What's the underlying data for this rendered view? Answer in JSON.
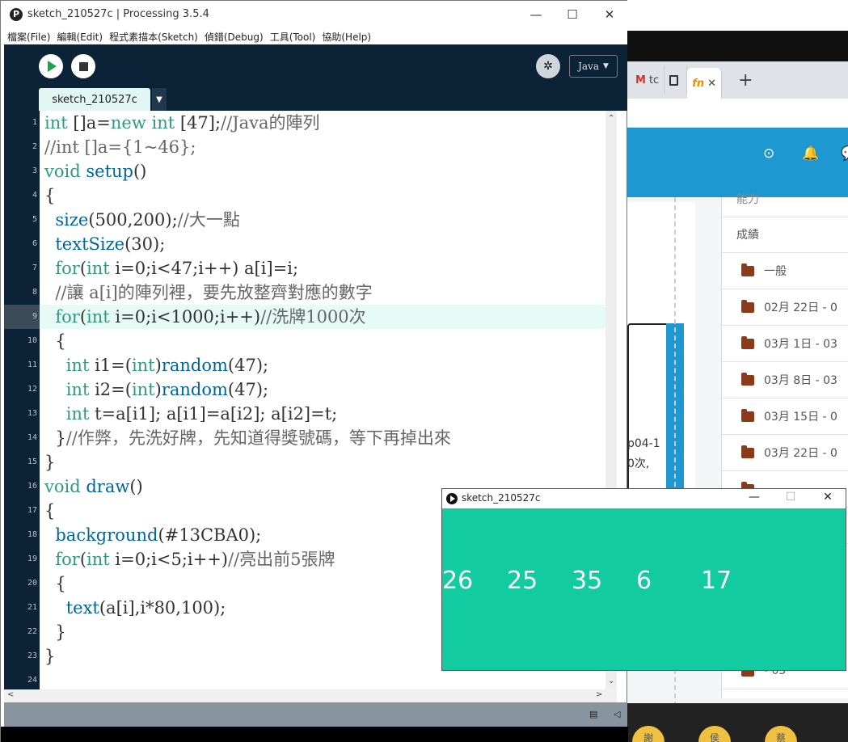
{
  "ide": {
    "window_title": "sketch_210527c | Processing 3.5.4",
    "app_icon_glyph": "P",
    "window_controls": {
      "minimize": "—",
      "maximize": "☐",
      "close": "✕"
    },
    "menu": [
      "檔案(File)",
      "編輯(Edit)",
      "程式素描本(Sketch)",
      "偵錯(Debug)",
      "工具(Tool)",
      "協助(Help)"
    ],
    "mode_label": "Java",
    "mode_arrow": "▼",
    "debug_glyph": "✲",
    "tab_name": "sketch_210527c",
    "tab_arrow": "▼",
    "highlighted_line": 9,
    "colors": {
      "toolbar_bg": "#0c2236",
      "keyword": "#33997e",
      "function": "#006699",
      "comment": "#666666"
    }
  },
  "code_lines": [
    [
      {
        "t": "int",
        "c": "kw"
      },
      {
        "t": " []a="
      },
      {
        "t": "new",
        "c": "kw"
      },
      {
        "t": " "
      },
      {
        "t": "int",
        "c": "kw"
      },
      {
        "t": " [47];"
      },
      {
        "t": "//Java的陣列",
        "c": "cm"
      }
    ],
    [
      {
        "t": "//int []a={1~46};",
        "c": "cm"
      }
    ],
    [
      {
        "t": "void",
        "c": "kw"
      },
      {
        "t": " "
      },
      {
        "t": "setup",
        "c": "fn"
      },
      {
        "t": "()"
      }
    ],
    [
      {
        "t": "{"
      }
    ],
    [
      {
        "t": "  "
      },
      {
        "t": "size",
        "c": "fn"
      },
      {
        "t": "(500,200);"
      },
      {
        "t": "//大一點",
        "c": "cm"
      }
    ],
    [
      {
        "t": "  "
      },
      {
        "t": "textSize",
        "c": "fn"
      },
      {
        "t": "(30);"
      }
    ],
    [
      {
        "t": "  "
      },
      {
        "t": "for",
        "c": "kw"
      },
      {
        "t": "("
      },
      {
        "t": "int",
        "c": "kw"
      },
      {
        "t": " i=0;i<47;i++) a[i]=i;"
      }
    ],
    [
      {
        "t": "  "
      },
      {
        "t": "//讓 a[i]的陣列裡，要先放整齊對應的數字",
        "c": "cm"
      }
    ],
    [
      {
        "t": "  "
      },
      {
        "t": "for",
        "c": "kw"
      },
      {
        "t": "("
      },
      {
        "t": "int",
        "c": "kw"
      },
      {
        "t": " i=0;i<1000;i++)"
      },
      {
        "t": "//洗牌1000次",
        "c": "cm"
      }
    ],
    [
      {
        "t": "  {"
      }
    ],
    [
      {
        "t": "    "
      },
      {
        "t": "int",
        "c": "kw"
      },
      {
        "t": " i1=("
      },
      {
        "t": "int",
        "c": "kw"
      },
      {
        "t": ")"
      },
      {
        "t": "random",
        "c": "fn"
      },
      {
        "t": "(47);"
      }
    ],
    [
      {
        "t": "    "
      },
      {
        "t": "int",
        "c": "kw"
      },
      {
        "t": " i2=("
      },
      {
        "t": "int",
        "c": "kw"
      },
      {
        "t": ")"
      },
      {
        "t": "random",
        "c": "fn"
      },
      {
        "t": "(47);"
      }
    ],
    [
      {
        "t": "    "
      },
      {
        "t": "int",
        "c": "kw"
      },
      {
        "t": " t=a[i1]; a[i1]=a[i2]; a[i2]=t;"
      }
    ],
    [
      {
        "t": "  }"
      },
      {
        "t": "//作弊，先洗好牌，先知道得獎號碼，等下再掉出來",
        "c": "cm"
      }
    ],
    [
      {
        "t": "}"
      }
    ],
    [
      {
        "t": "void",
        "c": "kw"
      },
      {
        "t": " "
      },
      {
        "t": "draw",
        "c": "fn"
      },
      {
        "t": "()"
      }
    ],
    [
      {
        "t": "{"
      }
    ],
    [
      {
        "t": "  "
      },
      {
        "t": "background",
        "c": "fn"
      },
      {
        "t": "(#13CBA0);"
      }
    ],
    [
      {
        "t": "  "
      },
      {
        "t": "for",
        "c": "kw"
      },
      {
        "t": "("
      },
      {
        "t": "int",
        "c": "kw"
      },
      {
        "t": " i=0;i<5;i++)"
      },
      {
        "t": "//亮出前5張牌",
        "c": "cm"
      }
    ],
    [
      {
        "t": "  {"
      }
    ],
    [
      {
        "t": "    "
      },
      {
        "t": "text",
        "c": "fn"
      },
      {
        "t": "(a[i],i*80,100);"
      }
    ],
    [
      {
        "t": "  }"
      }
    ],
    [
      {
        "t": "}"
      }
    ],
    []
  ],
  "status": {
    "console_glyph": "▤",
    "collapse_glyph": "◁"
  },
  "sketch_window": {
    "title": "sketch_210527c",
    "controls": {
      "minimize": "—",
      "maximize": "☐",
      "close": "✕"
    },
    "background": "#13CBA0",
    "cards": [
      "26",
      "25",
      "35",
      "6",
      "17"
    ]
  },
  "browser": {
    "tabs": [
      {
        "label": "tc",
        "icon": "gmail-icon",
        "glyph": "M"
      },
      {
        "label": "",
        "icon": "doc-icon",
        "glyph": ""
      },
      {
        "label": "",
        "icon": "fn-icon",
        "glyph": "fn"
      }
    ],
    "tab_close": "✕",
    "new_tab": "+",
    "header_icons": [
      "⊙",
      "🔔",
      "💬"
    ],
    "sidebar_top_frag": "能力",
    "sidebar_title": "成績",
    "sidebar_items": [
      "一般",
      "02月 22日 - 0",
      "03月 1日 - 03",
      "03月 8日 - 03",
      "03月 15日 - 0",
      "03月 22日 - 0",
      "",
      "",
      "- 05",
      ""
    ],
    "frag_text_1": "p04-1",
    "frag_text_2": "0次,",
    "avatars": [
      "謝",
      "侯",
      "蔡"
    ]
  }
}
